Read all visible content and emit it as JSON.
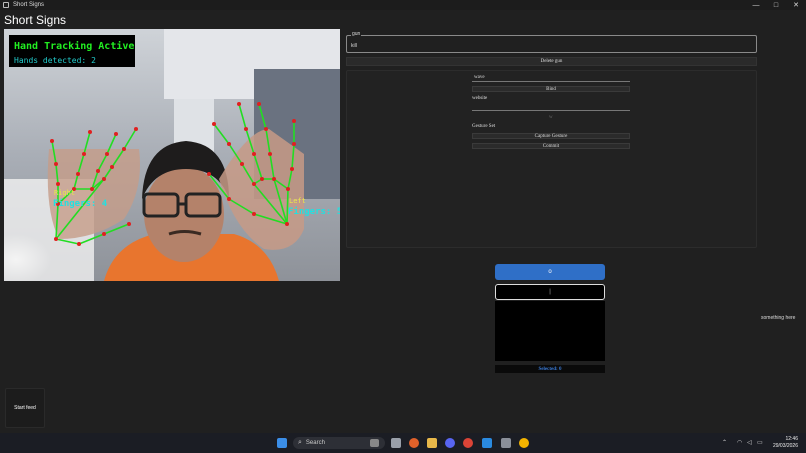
{
  "window": {
    "title": "Short Signs",
    "controls": {
      "minimize": "—",
      "maximize": "□",
      "close": "✕"
    }
  },
  "app": {
    "heading": "Short Signs"
  },
  "video": {
    "overlay_title": "Hand Tracking Active",
    "hands_detected": "Hands detected: 2",
    "right_hand": {
      "label": "Right",
      "fingers": "Fingers: 4"
    },
    "left_hand": {
      "label": "Left",
      "fingers": "Fingers: 5"
    },
    "colors": {
      "skeleton": "#22dd22",
      "joint": "#e02020",
      "overlay_title": "#22ee22",
      "overlay_sub": "#22cccc"
    }
  },
  "gun": {
    "label": "gun",
    "value": "kill",
    "delete_button": "Delete gun"
  },
  "bind_panel": {
    "gesture_field": "wave",
    "bind_button": "Bind",
    "website_label": "website",
    "website_value": "",
    "small_marker": "w",
    "gesture_set_label": "Gesture Set",
    "capture_button": "Capture Gesture",
    "commit_button": "Commit"
  },
  "controls_panel": {
    "blue_button": "o",
    "input_value": "|",
    "selected_text": "Selected: 0"
  },
  "status": {
    "something_here": "something here"
  },
  "start_feed": "Start feed",
  "taskbar": {
    "search_label": "Search",
    "time": "12:46",
    "date": "29/03/2026"
  }
}
